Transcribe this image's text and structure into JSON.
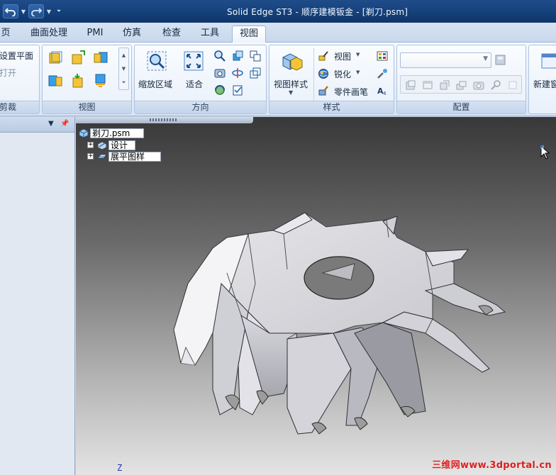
{
  "window": {
    "title": "Solid Edge ST3 - 顺序建模钣金 - [剃刀.psm]"
  },
  "tabs": [
    {
      "label": "页",
      "active": false
    },
    {
      "label": "曲面处理",
      "active": false
    },
    {
      "label": "PMI",
      "active": false
    },
    {
      "label": "仿真",
      "active": false
    },
    {
      "label": "检查",
      "active": false
    },
    {
      "label": "工具",
      "active": false
    },
    {
      "label": "视图",
      "active": true
    }
  ],
  "ribbon": {
    "clip_group": {
      "label": "剪裁",
      "set_plane": "设置平面",
      "open": "打开"
    },
    "views_group": {
      "label": "视图"
    },
    "orient_group": {
      "label": "方向",
      "zoom_area": "缩放区域",
      "fit": "适合"
    },
    "style_group": {
      "label": "样式",
      "view_style": "视图样式",
      "view": "视图",
      "sharpen": "锐化",
      "part_painter": "零件画笔"
    },
    "config_group": {
      "label": "配置",
      "combo_value": ""
    },
    "new_window_group": {
      "new": "新建窗"
    }
  },
  "tree": {
    "root": "剃刀.psm",
    "items": [
      {
        "label": "设计",
        "icon": "design-body-icon"
      },
      {
        "label": "展平图样",
        "icon": "flat-pattern-icon"
      }
    ]
  },
  "viewport": {
    "axis_label": "Z",
    "watermark": "三维网www.3dportal.cn"
  },
  "colors": {
    "titlebar": "#16437e",
    "ribbon": "#e5eef9",
    "viewport_top": "#383838",
    "viewport_bottom": "#e4e4e4",
    "watermark": "#d81e1e"
  }
}
